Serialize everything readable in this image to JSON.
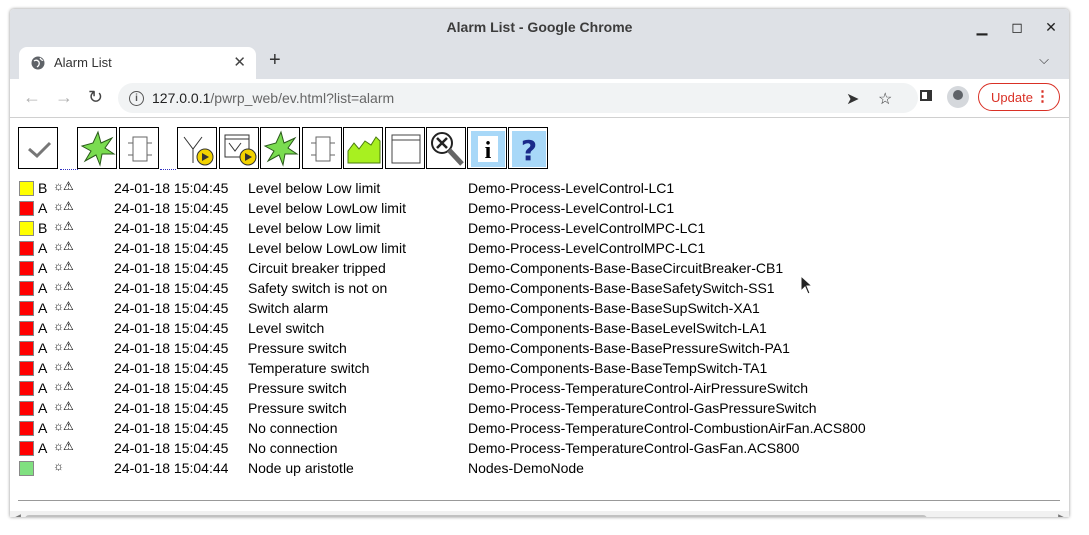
{
  "window": {
    "title": "Alarm List - Google Chrome"
  },
  "tab": {
    "label": "Alarm List",
    "close": "✕"
  },
  "browser": {
    "new_tab": "+",
    "url_host": "127.0.0.1",
    "url_path": "/pwrp_web/ev.html?list=alarm",
    "update_label": "Update"
  },
  "toolbar_buttons": [
    {
      "name": "acknowledge-button",
      "icon": "check-icon"
    },
    {
      "name": "blink-button",
      "icon": "green-star-icon"
    },
    {
      "name": "object-button",
      "icon": "object-icon"
    },
    {
      "name": "alarm-trend-button",
      "icon": "trend-play-icon"
    },
    {
      "name": "alarm-graph-button",
      "icon": "graph-play-icon"
    },
    {
      "name": "star-button",
      "icon": "green-star-icon"
    },
    {
      "name": "object-graph-button",
      "icon": "object-icon"
    },
    {
      "name": "trend-button",
      "icon": "area-trend-icon"
    },
    {
      "name": "window-button",
      "icon": "window-icon"
    },
    {
      "name": "crossref-button",
      "icon": "magnifier-x-icon"
    },
    {
      "name": "info-button",
      "icon": "info-icon"
    },
    {
      "name": "help-button",
      "icon": "question-icon"
    }
  ],
  "colors": {
    "red": "#ff0000",
    "yellow": "#ffff00",
    "green": "#80e080"
  },
  "alarms": [
    {
      "color": "yellow",
      "prio": "B",
      "ack": "☼⚠",
      "time": "24-01-18 15:04:45",
      "text": "Level below Low limit",
      "object": "Demo-Process-LevelControl-LC1"
    },
    {
      "color": "red",
      "prio": "A",
      "ack": "☼⚠",
      "time": "24-01-18 15:04:45",
      "text": "Level below LowLow limit",
      "object": "Demo-Process-LevelControl-LC1"
    },
    {
      "color": "yellow",
      "prio": "B",
      "ack": "☼⚠",
      "time": "24-01-18 15:04:45",
      "text": "Level below Low limit",
      "object": "Demo-Process-LevelControlMPC-LC1"
    },
    {
      "color": "red",
      "prio": "A",
      "ack": "☼⚠",
      "time": "24-01-18 15:04:45",
      "text": "Level below LowLow limit",
      "object": "Demo-Process-LevelControlMPC-LC1"
    },
    {
      "color": "red",
      "prio": "A",
      "ack": "☼⚠",
      "time": "24-01-18 15:04:45",
      "text": "Circuit breaker tripped",
      "object": "Demo-Components-Base-BaseCircuitBreaker-CB1"
    },
    {
      "color": "red",
      "prio": "A",
      "ack": "☼⚠",
      "time": "24-01-18 15:04:45",
      "text": "Safety switch is not on",
      "object": "Demo-Components-Base-BaseSafetySwitch-SS1"
    },
    {
      "color": "red",
      "prio": "A",
      "ack": "☼⚠",
      "time": "24-01-18 15:04:45",
      "text": "Switch alarm",
      "object": "Demo-Components-Base-BaseSupSwitch-XA1"
    },
    {
      "color": "red",
      "prio": "A",
      "ack": "☼⚠",
      "time": "24-01-18 15:04:45",
      "text": "Level switch",
      "object": "Demo-Components-Base-BaseLevelSwitch-LA1"
    },
    {
      "color": "red",
      "prio": "A",
      "ack": "☼⚠",
      "time": "24-01-18 15:04:45",
      "text": "Pressure switch",
      "object": "Demo-Components-Base-BasePressureSwitch-PA1"
    },
    {
      "color": "red",
      "prio": "A",
      "ack": "☼⚠",
      "time": "24-01-18 15:04:45",
      "text": "Temperature switch",
      "object": "Demo-Components-Base-BaseTempSwitch-TA1"
    },
    {
      "color": "red",
      "prio": "A",
      "ack": "☼⚠",
      "time": "24-01-18 15:04:45",
      "text": "Pressure switch",
      "object": "Demo-Process-TemperatureControl-AirPressureSwitch"
    },
    {
      "color": "red",
      "prio": "A",
      "ack": "☼⚠",
      "time": "24-01-18 15:04:45",
      "text": "Pressure switch",
      "object": "Demo-Process-TemperatureControl-GasPressureSwitch"
    },
    {
      "color": "red",
      "prio": "A",
      "ack": "☼⚠",
      "time": "24-01-18 15:04:45",
      "text": "No connection",
      "object": "Demo-Process-TemperatureControl-CombustionAirFan.ACS800"
    },
    {
      "color": "red",
      "prio": "A",
      "ack": "☼⚠",
      "time": "24-01-18 15:04:45",
      "text": "No connection",
      "object": "Demo-Process-TemperatureControl-GasFan.ACS800"
    },
    {
      "color": "green",
      "prio": "",
      "ack": "☼",
      "time": "24-01-18 15:04:44",
      "text": "Node up aristotle",
      "object": "Nodes-DemoNode"
    }
  ]
}
